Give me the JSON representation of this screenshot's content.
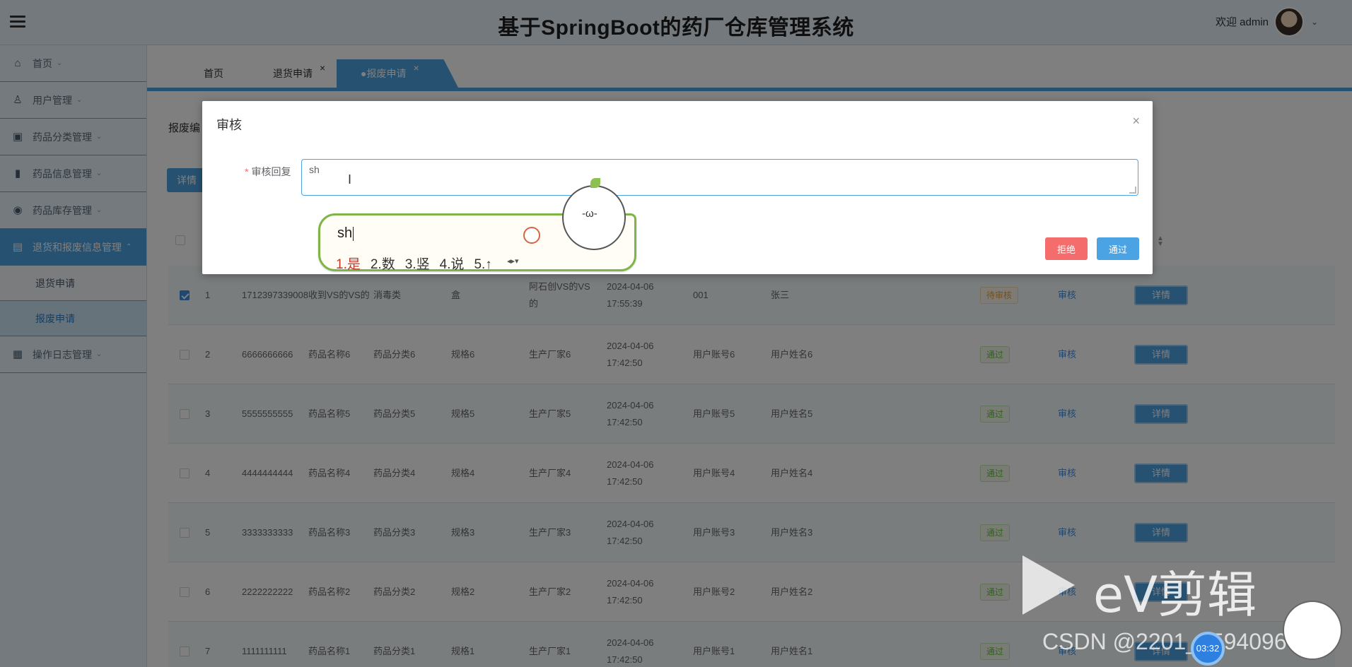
{
  "header": {
    "title": "基于SpringBoot的药厂仓库管理系统",
    "welcome": "欢迎 admin"
  },
  "sidebar": {
    "items": [
      {
        "label": "首页",
        "icon": "home-icon"
      },
      {
        "label": "用户管理",
        "icon": "user-icon"
      },
      {
        "label": "药品分类管理",
        "icon": "category-icon"
      },
      {
        "label": "药品信息管理",
        "icon": "book-icon"
      },
      {
        "label": "药品库存管理",
        "icon": "stock-icon"
      },
      {
        "label": "退货和报废信息管理",
        "icon": "folder-icon"
      },
      {
        "label": "操作日志管理",
        "icon": "log-icon"
      }
    ],
    "sub_items": [
      {
        "label": "退货申请"
      },
      {
        "label": "报废申请"
      }
    ]
  },
  "tabs": [
    {
      "label": "首页"
    },
    {
      "label": "退货申请",
      "close": "×"
    },
    {
      "label": "●报废申请",
      "close": "×"
    }
  ],
  "search": {
    "label": "报废编"
  },
  "toolbar": {
    "detail_label": "详情"
  },
  "table": {
    "rows": [
      {
        "idx": "1",
        "code": "1712397339008",
        "name": "收到VS的VS的",
        "category": "消毒类",
        "spec": "盒",
        "maker": "阿石创VS的VS的",
        "time": "2024-04-06 17:55:39",
        "account": "001",
        "user": "张三",
        "status": "待审核",
        "status_type": "pending",
        "checked": true
      },
      {
        "idx": "2",
        "code": "6666666666",
        "name": "药品名称6",
        "category": "药品分类6",
        "spec": "规格6",
        "maker": "生产厂家6",
        "time": "2024-04-06 17:42:50",
        "account": "用户账号6",
        "user": "用户姓名6",
        "status": "通过",
        "status_type": "pass",
        "checked": false
      },
      {
        "idx": "3",
        "code": "5555555555",
        "name": "药品名称5",
        "category": "药品分类5",
        "spec": "规格5",
        "maker": "生产厂家5",
        "time": "2024-04-06 17:42:50",
        "account": "用户账号5",
        "user": "用户姓名5",
        "status": "通过",
        "status_type": "pass",
        "checked": false
      },
      {
        "idx": "4",
        "code": "4444444444",
        "name": "药品名称4",
        "category": "药品分类4",
        "spec": "规格4",
        "maker": "生产厂家4",
        "time": "2024-04-06 17:42:50",
        "account": "用户账号4",
        "user": "用户姓名4",
        "status": "通过",
        "status_type": "pass",
        "checked": false
      },
      {
        "idx": "5",
        "code": "3333333333",
        "name": "药品名称3",
        "category": "药品分类3",
        "spec": "规格3",
        "maker": "生产厂家3",
        "time": "2024-04-06 17:42:50",
        "account": "用户账号3",
        "user": "用户姓名3",
        "status": "通过",
        "status_type": "pass",
        "checked": false
      },
      {
        "idx": "6",
        "code": "2222222222",
        "name": "药品名称2",
        "category": "药品分类2",
        "spec": "规格2",
        "maker": "生产厂家2",
        "time": "2024-04-06 17:42:50",
        "account": "用户账号2",
        "user": "用户姓名2",
        "status": "通过",
        "status_type": "pass",
        "checked": false
      },
      {
        "idx": "7",
        "code": "1111111111",
        "name": "药品名称1",
        "category": "药品分类1",
        "spec": "规格1",
        "maker": "生产厂家1",
        "time": "2024-04-06 17:42:50",
        "account": "用户账号1",
        "user": "用户姓名1",
        "status": "通过",
        "status_type": "pass",
        "checked": false
      }
    ],
    "audit_label": "审核",
    "detail_label": "详情"
  },
  "dialog": {
    "title": "审核",
    "close": "×",
    "field_label": "审核回复",
    "field_required": "*",
    "field_value": "sh",
    "reject_label": "拒绝",
    "pass_label": "通过"
  },
  "ime": {
    "input": "sh",
    "candidates": [
      "1.是",
      "2.数",
      "3.竖",
      "4.说",
      "5.↑"
    ]
  },
  "watermark": {
    "brand": "eV剪辑",
    "csdn": "CSDN @2201_75940964",
    "clock": "03:32"
  },
  "colors": {
    "accent": "#4ca3e3",
    "danger": "#f56c6c",
    "pending": "#e6a23c",
    "pass": "#67c23a"
  }
}
